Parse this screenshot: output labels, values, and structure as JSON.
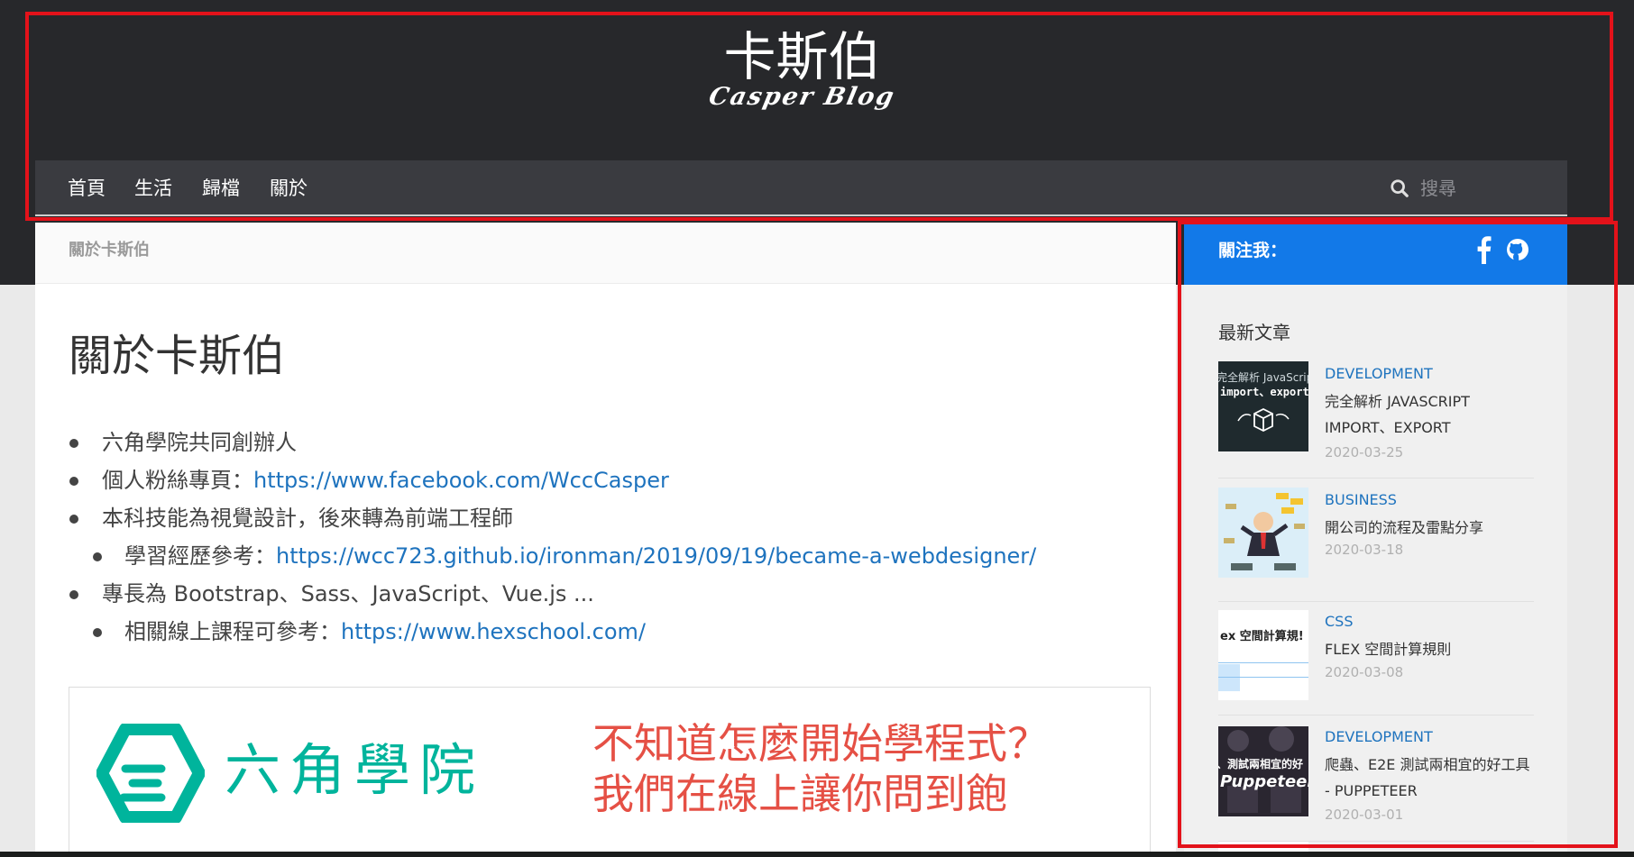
{
  "site": {
    "title": "卡斯伯",
    "subtitle": "Casper Blog"
  },
  "nav": {
    "items": [
      "首頁",
      "生活",
      "歸檔",
      "關於"
    ],
    "search_placeholder": "搜尋"
  },
  "breadcrumb": "關於卡斯伯",
  "page": {
    "title": "關於卡斯伯",
    "list": [
      {
        "text": "六角學院共同創辦人",
        "link": ""
      },
      {
        "text": "個人粉絲專頁：",
        "link": "https://www.facebook.com/WccCasper"
      },
      {
        "text": "本科技能為視覺設計，後來轉為前端工程師",
        "link": ""
      },
      {
        "text": "學習經歷參考：",
        "link": "https://wcc723.github.io/ironman/2019/09/19/became-a-webdesigner/"
      },
      {
        "text": "專長為 Bootstrap、Sass、JavaScript、Vue.js ...",
        "link": ""
      },
      {
        "text": "相關線上課程可參考：",
        "link": "https://www.hexschool.com/"
      }
    ]
  },
  "banner": {
    "brand": "六角學院",
    "slogan_line1": "不知道怎麼開始學程式？",
    "slogan_line2": "我們在線上讓你問到飽",
    "brand_color": "#00b49c",
    "slogan_color": "#e55045"
  },
  "sidebar": {
    "follow_title": "關注我：",
    "social_icons": [
      "facebook-icon",
      "github-icon"
    ],
    "recent_title": "最新文章",
    "posts": [
      {
        "category": "DEVELOPMENT",
        "title": "完全解析 JAVASCRIPT IMPORT、EXPORT",
        "date": "2020-03-25",
        "thumb_line1": "完全解析 JavaScrip",
        "thumb_line2": "import、export"
      },
      {
        "category": "BUSINESS",
        "title": "開公司的流程及雷點分享",
        "date": "2020-03-18"
      },
      {
        "category": "CSS",
        "title": "FLEX 空間計算規則",
        "date": "2020-03-08",
        "thumb_line1": "ex 空間計算規!"
      },
      {
        "category": "DEVELOPMENT",
        "title": "爬蟲、E2E 測試兩相宜的好工具 - PUPPETEER",
        "date": "2020-03-01",
        "thumb_line1": "、測試兩相宜的好",
        "thumb_line2": "Puppeteer"
      }
    ]
  },
  "colors": {
    "header_bg": "#27282b",
    "nav_bg": "#3a3b40",
    "accent": "#1279e8",
    "link": "#1e73be",
    "annotation": "#e3121a"
  }
}
